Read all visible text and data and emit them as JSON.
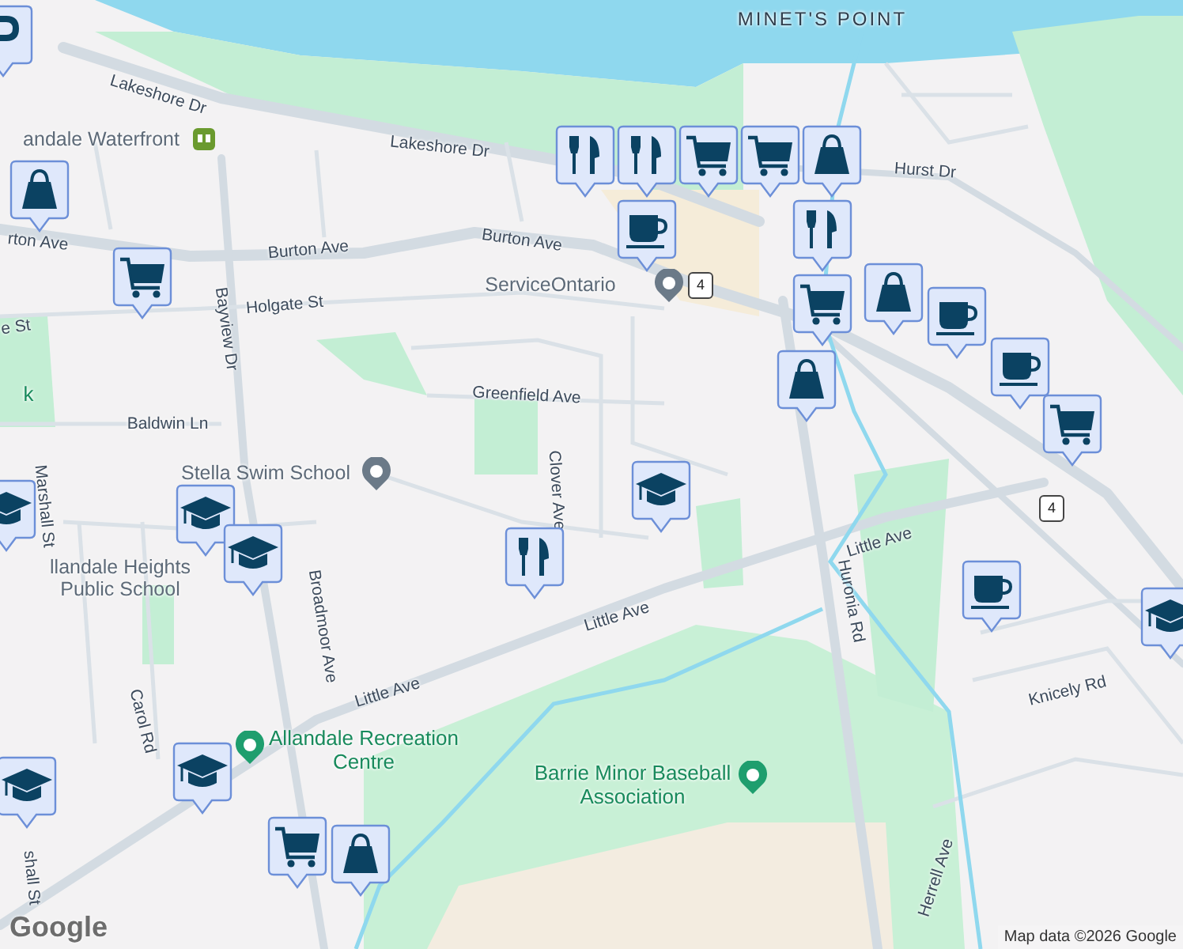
{
  "labels": [
    {
      "text": "MINET'S POINT",
      "kind": "area"
    },
    {
      "text": "Lakeshore Dr",
      "kind": "street"
    },
    {
      "text": "Lakeshore Dr",
      "kind": "street"
    },
    {
      "text": "Hurst Dr",
      "kind": "street"
    },
    {
      "text": "andale Waterfront",
      "kind": "place"
    },
    {
      "text": "rton Ave",
      "kind": "street"
    },
    {
      "text": "Burton Ave",
      "kind": "street"
    },
    {
      "text": "Burton Ave",
      "kind": "street"
    },
    {
      "text": "ServiceOntario",
      "kind": "place"
    },
    {
      "text": "Holgate St",
      "kind": "street"
    },
    {
      "text": "e St",
      "kind": "street"
    },
    {
      "text": "Bayview Dr",
      "kind": "street"
    },
    {
      "text": "Greenfield Ave",
      "kind": "street"
    },
    {
      "text": "Baldwin Ln",
      "kind": "street"
    },
    {
      "text": "k",
      "kind": "park"
    },
    {
      "text": "Clover Ave",
      "kind": "street"
    },
    {
      "text": "Stella Swim School",
      "kind": "place"
    },
    {
      "text": "Marshall St",
      "kind": "street"
    },
    {
      "text": "llandale Heights Public School",
      "kind": "place"
    },
    {
      "text": "Broadmoor Ave",
      "kind": "street"
    },
    {
      "text": "Little Ave",
      "kind": "street"
    },
    {
      "text": "Little Ave",
      "kind": "street"
    },
    {
      "text": "Little Ave",
      "kind": "street"
    },
    {
      "text": "Carol Rd",
      "kind": "street"
    },
    {
      "text": "Allandale Recreation Centre",
      "kind": "park"
    },
    {
      "text": "Barrie Minor Baseball Association",
      "kind": "park"
    },
    {
      "text": "Huronia Rd",
      "kind": "street"
    },
    {
      "text": "Knicely Rd",
      "kind": "street"
    },
    {
      "text": "Herrell Ave",
      "kind": "street"
    },
    {
      "text": "shall St",
      "kind": "street"
    }
  ],
  "shields": [
    "4",
    "4"
  ],
  "pins": [
    {
      "kind": "parking"
    },
    {
      "kind": "bag"
    },
    {
      "kind": "cart"
    },
    {
      "kind": "cap"
    },
    {
      "kind": "cap"
    },
    {
      "kind": "cap"
    },
    {
      "kind": "fork"
    },
    {
      "kind": "cap"
    },
    {
      "kind": "cap"
    },
    {
      "kind": "cap"
    },
    {
      "kind": "cart"
    },
    {
      "kind": "bag"
    },
    {
      "kind": "fork"
    },
    {
      "kind": "cart"
    },
    {
      "kind": "cart"
    },
    {
      "kind": "fork"
    },
    {
      "kind": "cup"
    },
    {
      "kind": "bag"
    },
    {
      "kind": "fork"
    },
    {
      "kind": "cart"
    },
    {
      "kind": "bag"
    },
    {
      "kind": "bag"
    },
    {
      "kind": "cup"
    },
    {
      "kind": "cup"
    },
    {
      "kind": "cart"
    },
    {
      "kind": "cup"
    },
    {
      "kind": "cap"
    }
  ],
  "attribution": "Map data ©2026 Google",
  "logo": "Google"
}
